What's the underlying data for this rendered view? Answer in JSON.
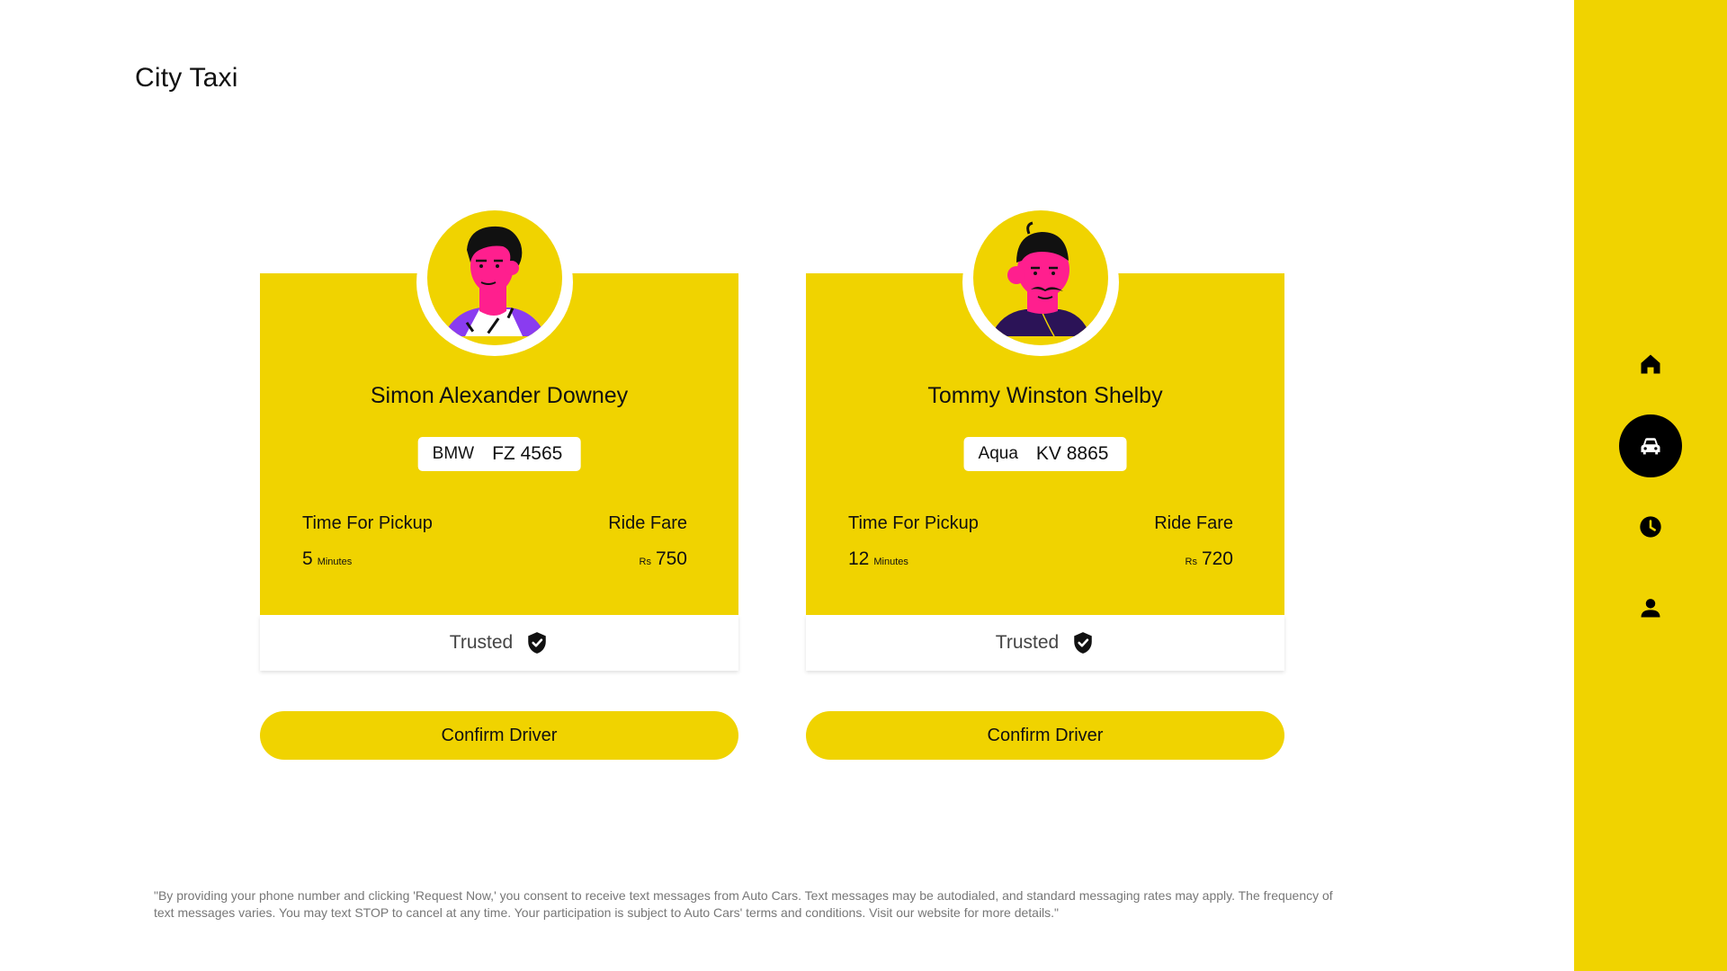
{
  "app": {
    "title": "City Taxi"
  },
  "drivers": [
    {
      "name": "Simon Alexander Downey",
      "car_make": "BMW",
      "plate_number": "FZ 4565",
      "pickup_label": "Time For Pickup",
      "pickup_value": "5",
      "pickup_unit": "Minutes",
      "fare_label": "Ride Fare",
      "fare_currency": "Rs",
      "fare_value": "750",
      "trusted_label": "Trusted",
      "confirm_label": "Confirm Driver"
    },
    {
      "name": "Tommy Winston Shelby",
      "car_make": "Aqua",
      "plate_number": "KV 8865",
      "pickup_label": "Time For Pickup",
      "pickup_value": "12",
      "pickup_unit": "Minutes",
      "fare_label": "Ride Fare",
      "fare_currency": "Rs",
      "fare_value": "720",
      "trusted_label": "Trusted",
      "confirm_label": "Confirm Driver"
    }
  ],
  "disclaimer": "\"By providing your phone number and clicking 'Request Now,' you consent to receive text messages from Auto Cars. Text messages may be autodialed, and standard messaging rates may apply. The frequency of text messages varies. You may text STOP to cancel at any time. Your participation is subject to Auto Cars' terms and conditions. Visit our website for more details.\"",
  "sidebar": {
    "items": [
      {
        "icon": "home-icon",
        "active": false
      },
      {
        "icon": "car-icon",
        "active": true
      },
      {
        "icon": "clock-icon",
        "active": false
      },
      {
        "icon": "user-icon",
        "active": false
      }
    ]
  },
  "colors": {
    "accent": "#f0d300",
    "avatar_skin": "#ff1f8e",
    "avatar_shirt_1": "#8a3cf0",
    "avatar_shirt_2": "#2b1357",
    "dark": "#000000"
  }
}
